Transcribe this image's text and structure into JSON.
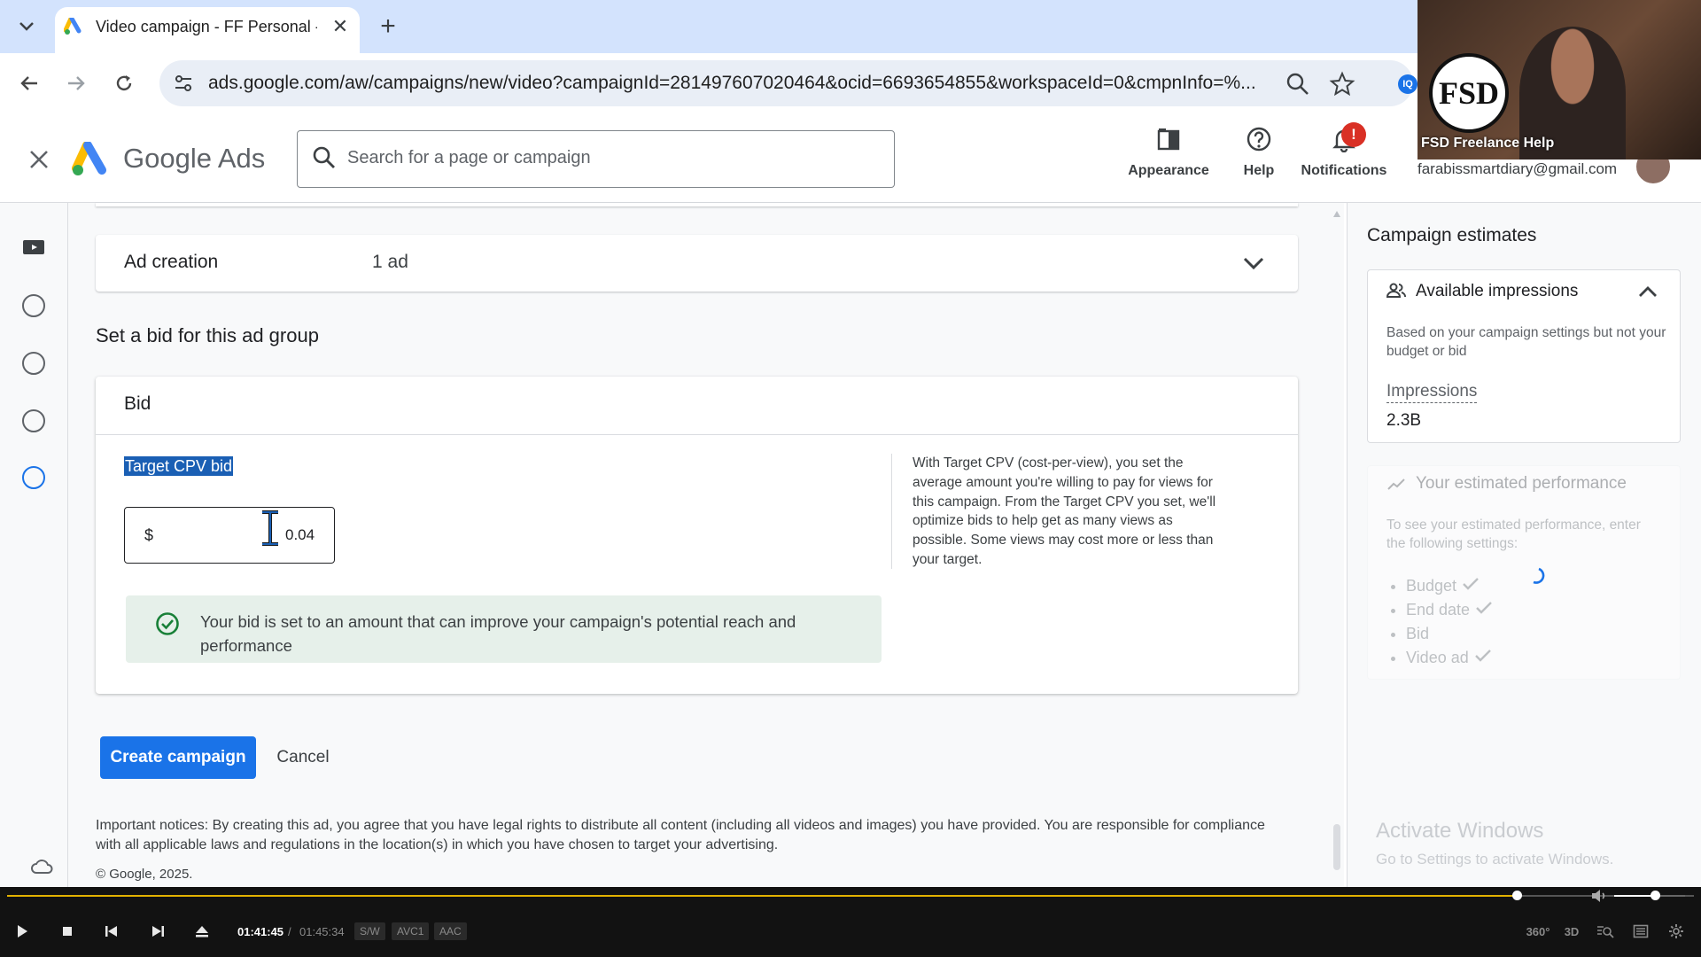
{
  "browser": {
    "tab_title": "Video campaign - FF Personal -",
    "url": "ads.google.com/aw/campaigns/new/video?campaignId=281497607020464&ocid=6693654855&workspaceId=0&cmpnInfo=%...",
    "extension_badge": "IQ"
  },
  "header": {
    "wordmark": "Google Ads",
    "search_placeholder": "Search for a page or campaign",
    "appearance_label": "Appearance",
    "help_label": "Help",
    "notifications_label": "Notifications",
    "notifications_badge": "!",
    "account_email": "farabissmartdiary@gmail.com"
  },
  "webcam": {
    "logo_text": "FSD",
    "label": "FSD Freelance Help"
  },
  "main": {
    "ad_creation": {
      "title": "Ad creation",
      "value": "1 ad"
    },
    "bid_heading": "Set a bid for this ad group",
    "bid_card": {
      "title": "Bid",
      "field_label": "Target CPV bid",
      "currency": "$",
      "value": "0.04",
      "help_text": "With Target CPV (cost-per-view), you set the average amount you're willing to pay for views for this campaign. From the Target CPV you set, we'll optimize bids to help get as many views as possible. Some views may cost more or less than your target.",
      "success_message": "Your bid is set to an amount that can improve your campaign's potential reach and performance"
    },
    "create_button": "Create campaign",
    "cancel_button": "Cancel",
    "notice": "Important notices: By creating this ad, you agree that you have legal rights to distribute all content (including all videos and images) you have provided. You are responsible for compliance with all applicable laws and regulations in the location(s) in which you have chosen to target your advertising.",
    "copyright": "© Google, 2025."
  },
  "right_panel": {
    "title": "Campaign estimates",
    "impressions_card": {
      "title": "Available impressions",
      "description": "Based on your campaign settings but not your budget or bid",
      "label": "Impressions",
      "value": "2.3B"
    },
    "performance": {
      "title": "Your estimated performance",
      "description": "To see your estimated performance, enter the following settings:",
      "items": [
        {
          "label": "Budget",
          "done": true
        },
        {
          "label": "End date",
          "done": true
        },
        {
          "label": "Bid",
          "done": false
        },
        {
          "label": "Video ad",
          "done": true
        }
      ]
    },
    "watermark_title": "Activate Windows",
    "watermark_sub": "Go to Settings to activate Windows."
  },
  "player": {
    "current_time": "01:41:45",
    "separator": "/",
    "total_time": "01:45:34",
    "progress": 0.895,
    "volume": 0.58,
    "codecs": [
      "S/W",
      "AVC1",
      "AAC"
    ],
    "right_icons": [
      "360°",
      "3D"
    ]
  },
  "colors": {
    "primary": "#1a73e8",
    "success_bg": "#e6f0ea",
    "success_icon": "#188038",
    "badge": "#d93025",
    "seek_bar": "#e2b100"
  }
}
